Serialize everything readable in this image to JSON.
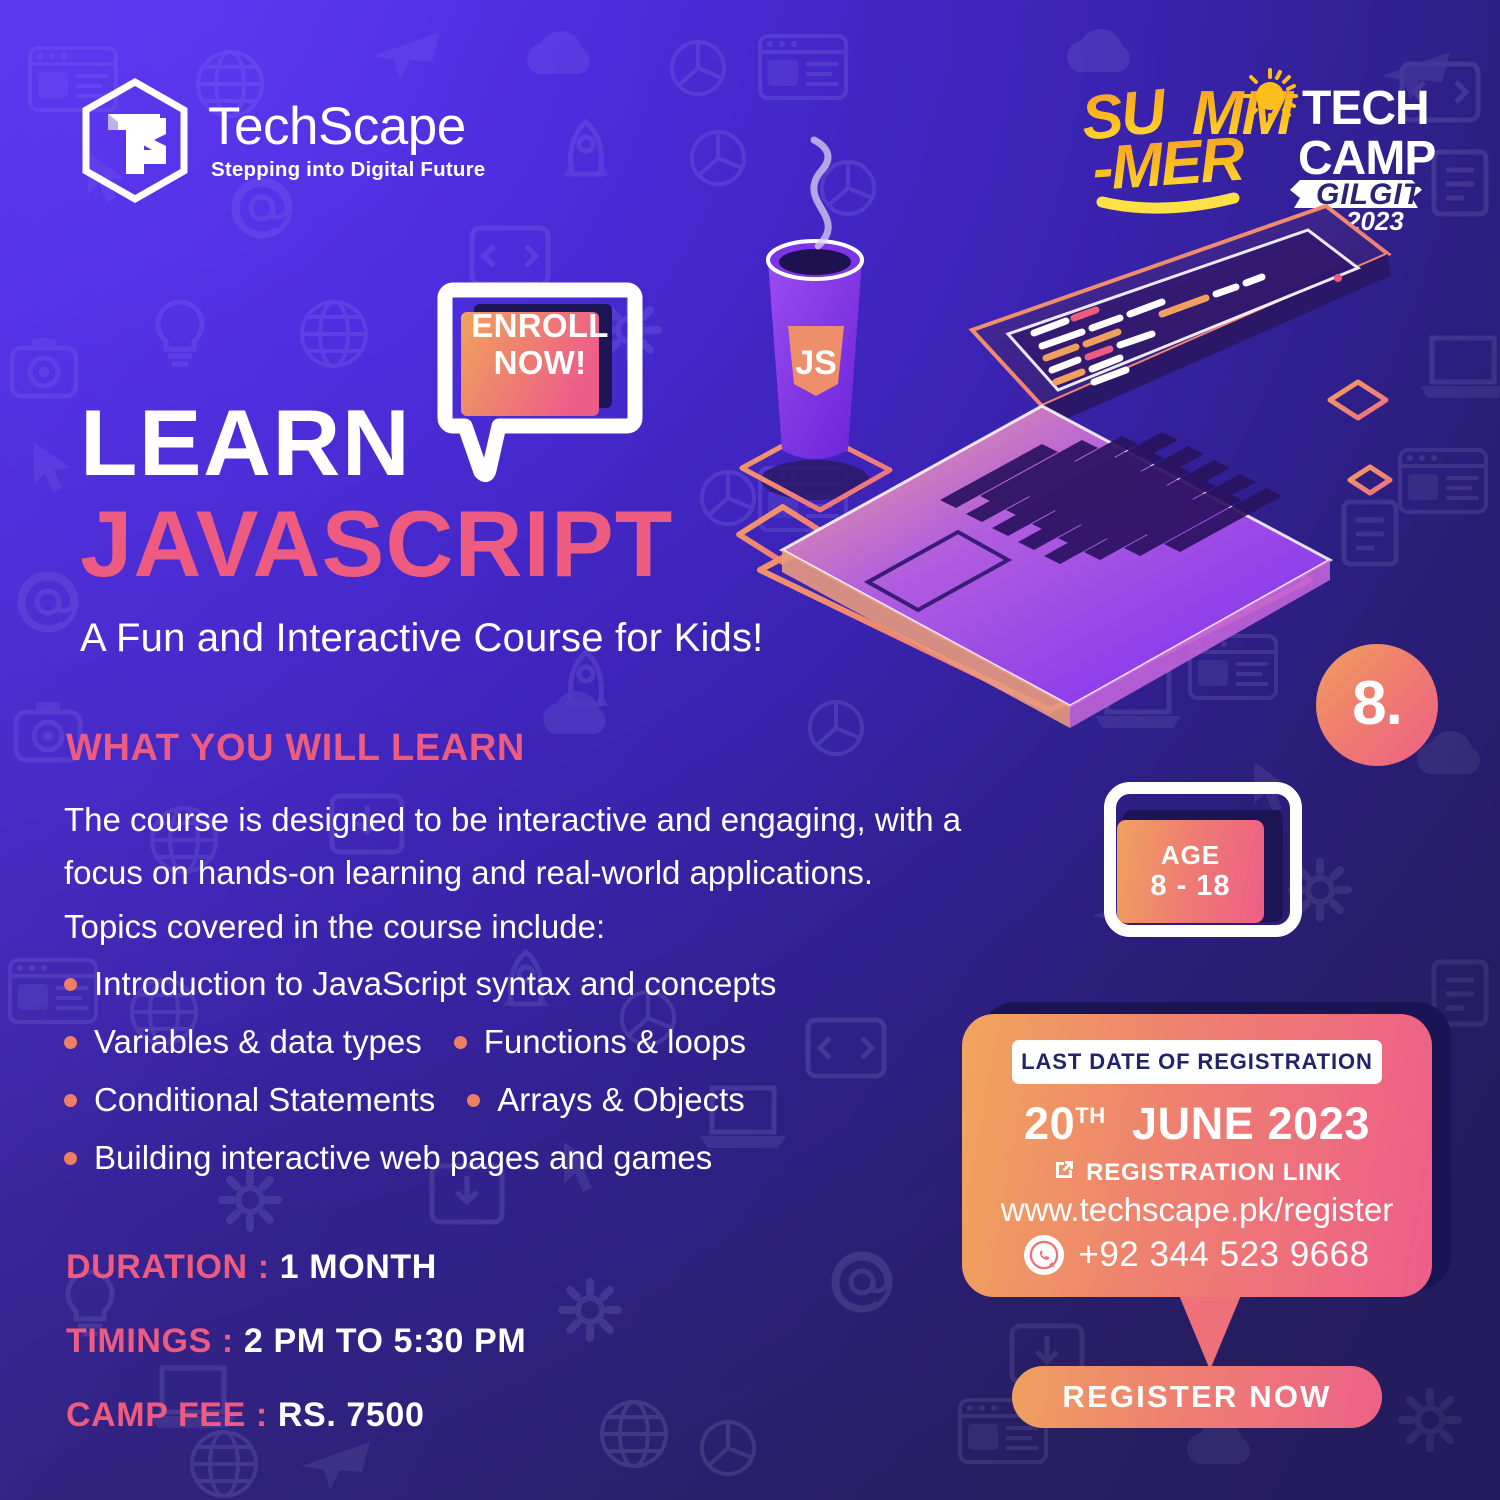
{
  "brand": {
    "name": "TechScape",
    "tagline": "Stepping into Digital Future",
    "logo_icon": "techscape-hexagon-ts-logo"
  },
  "camp_badge": {
    "summer": "SUMMER",
    "sun_icon": "sun-icon",
    "tech": "TECH",
    "camp": "CAMP",
    "city": "GILGIT",
    "year": "2023"
  },
  "enroll": {
    "line1": "ENROLL",
    "line2": "NOW!"
  },
  "headline": {
    "learn": "LEARN",
    "subject": "JAVASCRIPT",
    "subtitle": "A Fun and Interactive Course for Kids!"
  },
  "learn_section": {
    "title": "WHAT YOU WILL LEARN",
    "description": "The course is designed to be interactive and engaging, with a focus on hands-on learning and real-world applications. Topics covered in the course include:",
    "bullet_rows": [
      [
        "Introduction to JavaScript syntax and concepts"
      ],
      [
        "Variables & data types",
        "Functions & loops"
      ],
      [
        "Conditional Statements",
        "Arrays & Objects"
      ],
      [
        "Building interactive web pages and games"
      ]
    ]
  },
  "details": [
    {
      "label": "DURATION :",
      "value": "1 MONTH"
    },
    {
      "label": "TIMINGS :",
      "value": "2 PM TO 5:30 PM"
    },
    {
      "label": "CAMP FEE :",
      "value": "RS. 7500"
    }
  ],
  "number_badge": "8.",
  "age_badge": {
    "label": "AGE",
    "range": "8 - 18"
  },
  "registration": {
    "header": "LAST DATE OF REGISTRATION",
    "date_day": "20",
    "date_suffix": "TH",
    "date_rest": "JUNE 2023",
    "link_icon": "external-link-icon",
    "link_label": "REGISTRATION LINK",
    "url": "www.techscape.pk/register",
    "whatsapp_icon": "whatsapp-icon",
    "phone": "+92 344 523 9668",
    "cta": "REGISTER NOW"
  },
  "illustration": {
    "laptop_icon": "isometric-laptop-with-code-icon",
    "coffee_cup_icon": "coffee-cup-with-js-logo-icon",
    "js_label": "JS"
  },
  "colors": {
    "bg_top": "#4A2BDC",
    "bg_bottom": "#2A2067",
    "accent_pink": "#ED5C80",
    "accent_orange": "#EFA05F",
    "navy_text": "#22246B",
    "bullet": "#EE7E64"
  }
}
